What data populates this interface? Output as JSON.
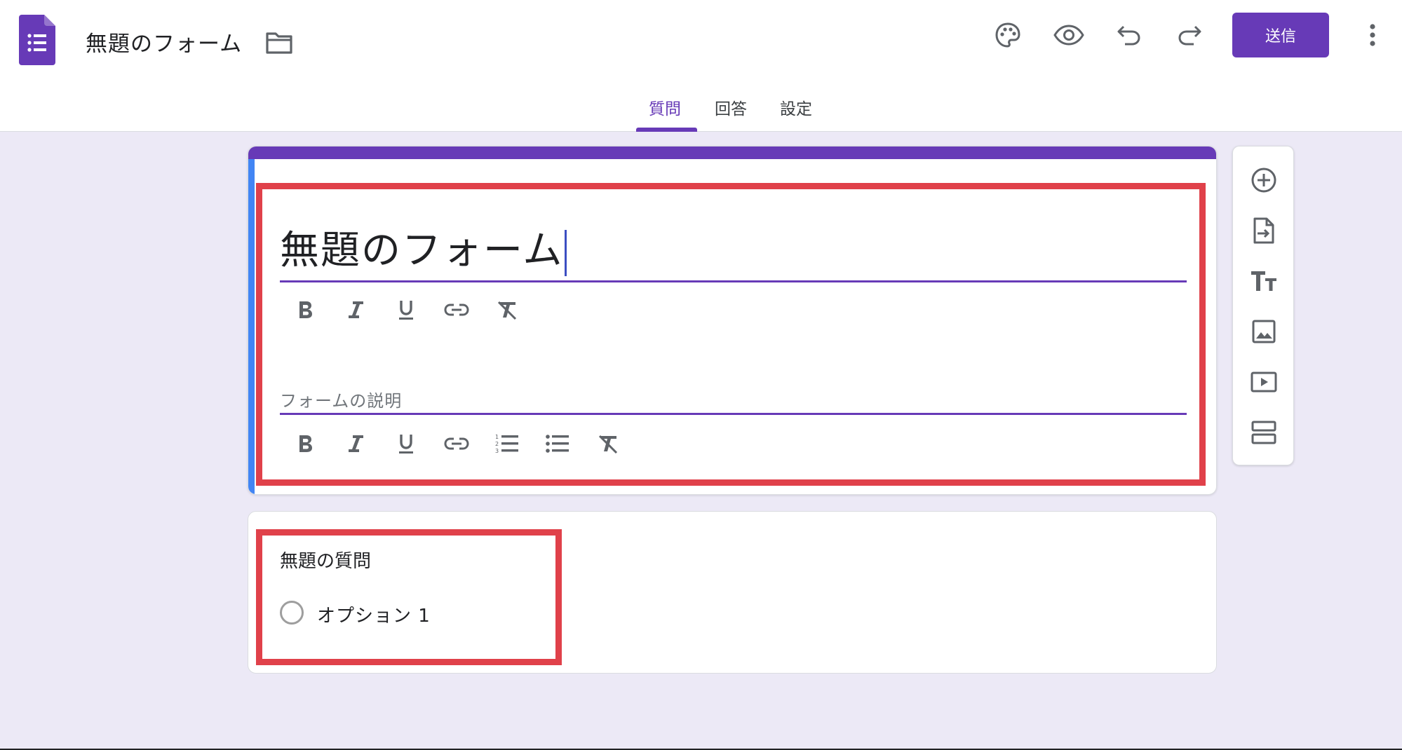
{
  "header": {
    "doc_title": "無題のフォーム",
    "send_label": "送信",
    "icons": [
      "palette-icon",
      "eye-icon",
      "undo-icon",
      "redo-icon",
      "more-vert-icon",
      "folder-icon",
      "forms-logo-icon"
    ]
  },
  "tabs": [
    {
      "label": "質問",
      "active": true
    },
    {
      "label": "回答",
      "active": false
    },
    {
      "label": "設定",
      "active": false
    }
  ],
  "title_card": {
    "title": "無題のフォーム",
    "description_placeholder": "フォームの説明",
    "title_format_buttons": [
      "bold-icon",
      "italic-icon",
      "underline-icon",
      "link-icon",
      "clear-format-icon"
    ],
    "desc_format_buttons": [
      "bold-icon",
      "italic-icon",
      "underline-icon",
      "link-icon",
      "numbered-list-icon",
      "bulleted-list-icon",
      "clear-format-icon"
    ]
  },
  "side_toolbar": [
    "add-question-icon",
    "import-questions-icon",
    "add-title-icon",
    "add-image-icon",
    "add-video-icon",
    "add-section-icon"
  ],
  "question": {
    "title": "無題の質問",
    "options": [
      "オプション 1"
    ]
  },
  "colors": {
    "accent": "#673ab7",
    "background": "#ece9f6",
    "highlight": "#e0414a",
    "left_bar": "#4285f4"
  }
}
